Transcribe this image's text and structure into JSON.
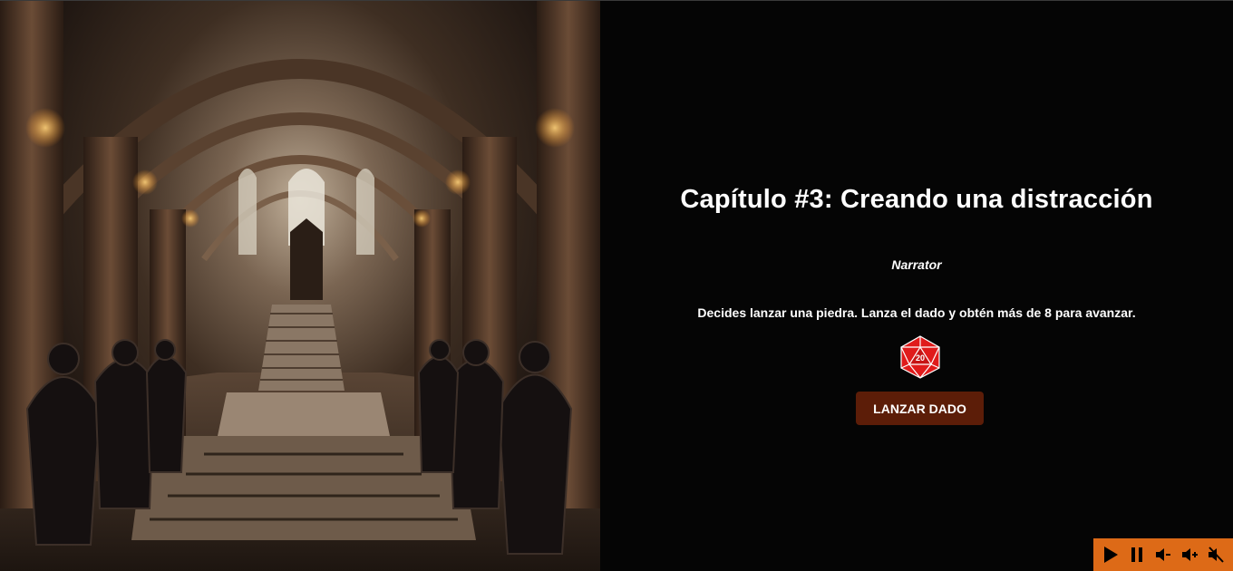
{
  "scene": {
    "name": "castle-throne-hall-image"
  },
  "story": {
    "chapter_title": "Capítulo #3: Creando una distracción",
    "speaker": "Narrator",
    "dialogue": "Decides lanzar una piedra. Lanza el dado y obtén más de 8 para avanzar.",
    "die_face": "20",
    "die_color": "#e01b1b",
    "roll_button_label": "LANZAR DADO",
    "roll_button_color": "#5c1d08"
  },
  "audio_controls": {
    "background_color": "#dd6a17",
    "items": [
      {
        "icon": "play-icon"
      },
      {
        "icon": "pause-icon"
      },
      {
        "icon": "volume-down-icon"
      },
      {
        "icon": "volume-up-icon"
      },
      {
        "icon": "mute-icon"
      }
    ]
  }
}
